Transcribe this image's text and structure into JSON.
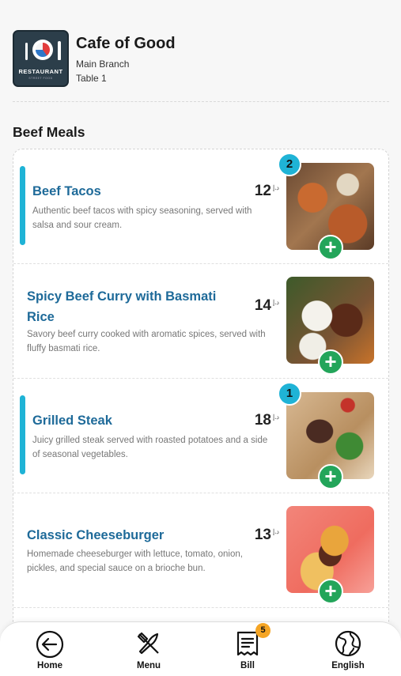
{
  "restaurant": {
    "logo_text": "RESTAURANT",
    "logo_subtext": "STREET FOOD",
    "name": "Cafe of Good",
    "branch": "Main Branch",
    "table": "Table 1"
  },
  "section": {
    "title": "Beef Meals"
  },
  "items": [
    {
      "name": "Beef Tacos",
      "description": "Authentic beef tacos with spicy seasoning, served with salsa and sour cream.",
      "price": "12",
      "currency": "د.إ",
      "quantity": "2",
      "image": "beef-tacos-photo",
      "add": "+"
    },
    {
      "name": "Spicy Beef Curry with Basmati Rice",
      "description": "Savory beef curry cooked with aromatic spices, served with fluffy basmati rice.",
      "price": "14",
      "currency": "د.إ",
      "quantity": "",
      "image": "beef-curry-photo",
      "add": "+"
    },
    {
      "name": "Grilled Steak",
      "description": "Juicy grilled steak served with roasted potatoes and a side of seasonal vegetables.",
      "price": "18",
      "currency": "د.إ",
      "quantity": "1",
      "image": "grilled-steak-photo",
      "add": "+"
    },
    {
      "name": "Classic Cheeseburger",
      "description": "Homemade cheeseburger with lettuce, tomato, onion, pickles, and special sauce on a brioche bun.",
      "price": "13",
      "currency": "د.إ",
      "quantity": "",
      "image": "cheeseburger-photo",
      "add": "+"
    }
  ],
  "nav": {
    "home": {
      "label": "Home",
      "icon": "back-arrow-circle-icon"
    },
    "menu": {
      "label": "Menu",
      "icon": "fork-knife-icon"
    },
    "bill": {
      "label": "Bill",
      "icon": "receipt-icon",
      "badge": "5"
    },
    "language": {
      "label": "English",
      "icon": "globe-icon"
    }
  },
  "colors": {
    "accent": "#1fb3d6",
    "item_title": "#1e6a99",
    "add_button": "#23a55a",
    "badge": "#f5a524"
  }
}
